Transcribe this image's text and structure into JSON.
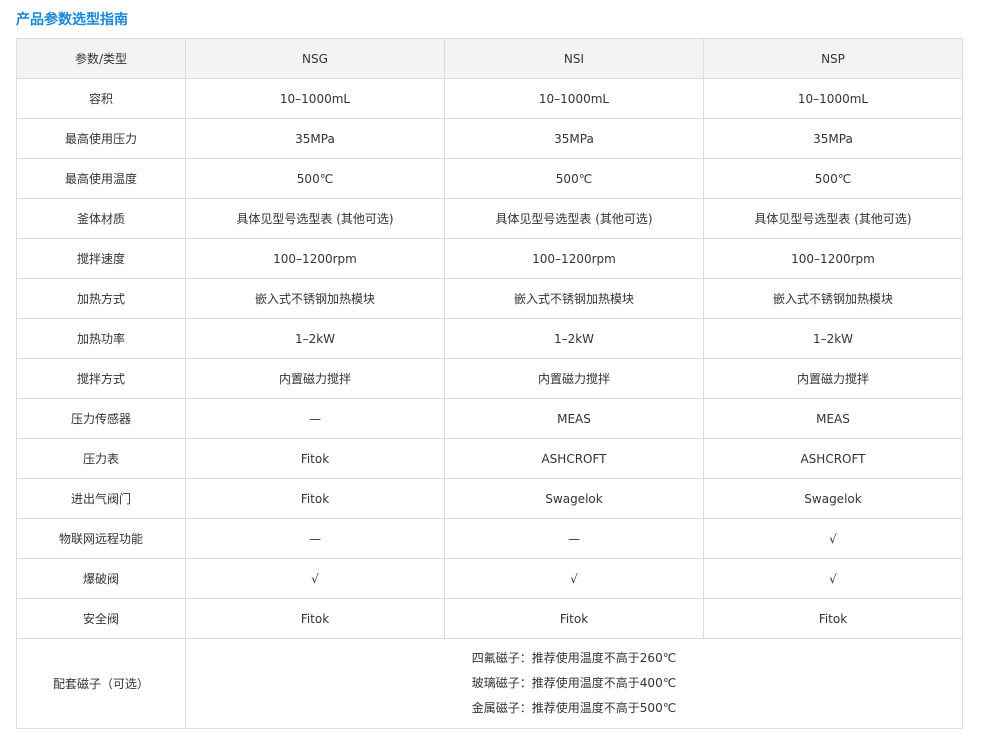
{
  "title": "产品参数选型指南",
  "table": {
    "headers": [
      "参数/类型",
      "NSG",
      "NSI",
      "NSP"
    ],
    "rows": [
      {
        "param": "容积",
        "values": [
          "10–1000mL",
          "10–1000mL",
          "10–1000mL"
        ]
      },
      {
        "param": "最高使用压力",
        "values": [
          "35MPa",
          "35MPa",
          "35MPa"
        ]
      },
      {
        "param": "最高使用温度",
        "values": [
          "500℃",
          "500℃",
          "500℃"
        ]
      },
      {
        "param": "釜体材质",
        "values": [
          "具体见型号选型表 (其他可选)",
          "具体见型号选型表 (其他可选)",
          "具体见型号选型表 (其他可选)"
        ]
      },
      {
        "param": "搅拌速度",
        "values": [
          "100–1200rpm",
          "100–1200rpm",
          "100–1200rpm"
        ]
      },
      {
        "param": "加热方式",
        "values": [
          "嵌入式不锈钢加热模块",
          "嵌入式不锈钢加热模块",
          "嵌入式不锈钢加热模块"
        ]
      },
      {
        "param": "加热功率",
        "values": [
          "1–2kW",
          "1–2kW",
          "1–2kW"
        ]
      },
      {
        "param": "搅拌方式",
        "values": [
          "内置磁力搅拌",
          "内置磁力搅拌",
          "内置磁力搅拌"
        ]
      },
      {
        "param": "压力传感器",
        "values": [
          "—",
          "MEAS",
          "MEAS"
        ]
      },
      {
        "param": "压力表",
        "values": [
          "Fitok",
          "ASHCROFT",
          "ASHCROFT"
        ]
      },
      {
        "param": "进出气阀门",
        "values": [
          "Fitok",
          "Swagelok",
          "Swagelok"
        ]
      },
      {
        "param": "物联网远程功能",
        "values": [
          "—",
          "—",
          "√"
        ]
      },
      {
        "param": "爆破阀",
        "values": [
          "√",
          "√",
          "√"
        ]
      },
      {
        "param": "安全阀",
        "values": [
          "Fitok",
          "Fitok",
          "Fitok"
        ]
      }
    ],
    "magnet_row": {
      "param": "配套磁子（可选）",
      "lines": [
        "四氟磁子：推荐使用温度不高于260℃",
        "玻璃磁子：推荐使用温度不高于400℃",
        "金属磁子：推荐使用温度不高于500℃"
      ]
    }
  }
}
